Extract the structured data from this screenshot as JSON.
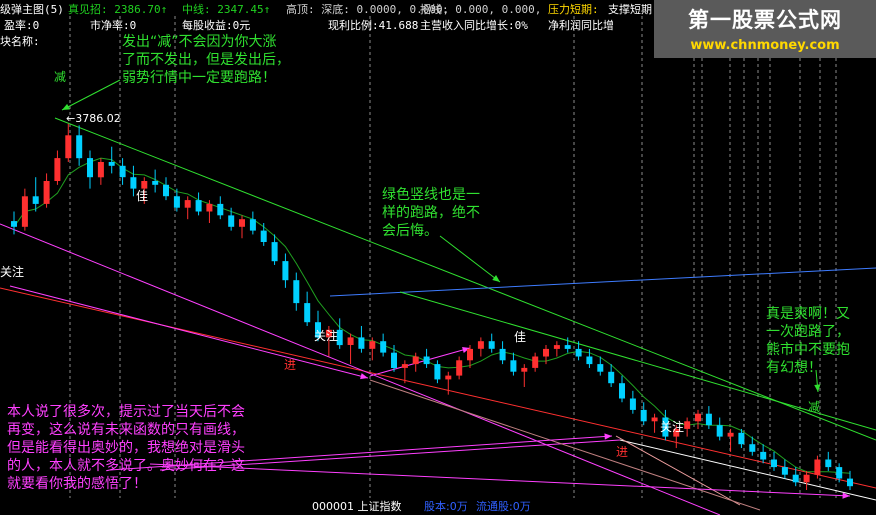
{
  "header": {
    "row1_left": "级弹主图(5)",
    "row1_items": [
      {
        "text": "真见招: 2386.70↑",
        "color": "#20d020"
      },
      {
        "text": "中线: 2347.45↑",
        "color": "#20d020"
      },
      {
        "text": "高顶: 深底: 0.0000, 0.000,",
        "color": "#d0d0d0"
      },
      {
        "text": "招线: 0.000, 0.000,",
        "color": "#d0d0d0"
      },
      {
        "text": "压力短期:",
        "color": "#ffd800"
      },
      {
        "text": "支撑短期",
        "color": "#ffffff"
      }
    ],
    "row2_items": [
      {
        "text": "盈率:0",
        "color": "#ffffff"
      },
      {
        "text": "市净率:0",
        "color": "#ffffff"
      },
      {
        "text": "每股收益:0元",
        "color": "#ffffff"
      },
      {
        "text": "现利比例:41.688",
        "color": "#ffffff"
      },
      {
        "text": "主营收入同比增长:0%",
        "color": "#ffffff"
      },
      {
        "text": "净利润同比增",
        "color": "#ffffff"
      }
    ],
    "row3_left": "块名称:"
  },
  "logo": {
    "line1": "第一股票公式网",
    "line2": "www.chnmoney.com"
  },
  "annotations": {
    "top_note": "发出“减”不会因为你大涨\n了而不发出，但是发出后，\n弱势行情中一定要跑路！",
    "mid_note": "绿色竖线也是一\n样的跑路，绝不\n会后悔。",
    "right_note": "真是爽啊！又\n一次跑路了，\n熊市中不要抱\n有幻想！",
    "left_note": "本人说了很多次，提示过了当天后不会\n再变，这么说有未来函数的只有画线，\n但是能看得出奥妙的，我想绝对是滑头\n的人，本人就不多说了。奥妙何在？这\n就要看你我的感悟了！"
  },
  "signals": {
    "jian": "减",
    "guanzhu": "关注",
    "jia": "佳",
    "jin": "进",
    "price_label": "←3786.02"
  },
  "footer": {
    "code": "000001 上证指数",
    "guben": "股本:0万",
    "liutong": "流通股:0万"
  },
  "chart_data": {
    "type": "candlestick",
    "price_high_label": 3786.02,
    "candles": [
      [
        3535,
        3560,
        3500,
        3520
      ],
      [
        3520,
        3620,
        3510,
        3600
      ],
      [
        3600,
        3650,
        3560,
        3580
      ],
      [
        3580,
        3660,
        3570,
        3640
      ],
      [
        3640,
        3720,
        3630,
        3700
      ],
      [
        3700,
        3790,
        3690,
        3760
      ],
      [
        3760,
        3786,
        3680,
        3700
      ],
      [
        3700,
        3720,
        3620,
        3650
      ],
      [
        3650,
        3700,
        3630,
        3690
      ],
      [
        3690,
        3730,
        3660,
        3680
      ],
      [
        3680,
        3700,
        3630,
        3650
      ],
      [
        3650,
        3680,
        3600,
        3620
      ],
      [
        3620,
        3650,
        3580,
        3640
      ],
      [
        3640,
        3670,
        3610,
        3630
      ],
      [
        3630,
        3650,
        3590,
        3600
      ],
      [
        3600,
        3620,
        3560,
        3570
      ],
      [
        3570,
        3600,
        3540,
        3590
      ],
      [
        3590,
        3610,
        3550,
        3560
      ],
      [
        3560,
        3590,
        3530,
        3580
      ],
      [
        3580,
        3600,
        3540,
        3550
      ],
      [
        3550,
        3570,
        3510,
        3520
      ],
      [
        3520,
        3550,
        3490,
        3540
      ],
      [
        3540,
        3560,
        3500,
        3510
      ],
      [
        3510,
        3530,
        3470,
        3480
      ],
      [
        3480,
        3500,
        3420,
        3430
      ],
      [
        3430,
        3450,
        3360,
        3380
      ],
      [
        3380,
        3400,
        3300,
        3320
      ],
      [
        3320,
        3350,
        3260,
        3270
      ],
      [
        3270,
        3300,
        3220,
        3230
      ],
      [
        3230,
        3260,
        3180,
        3250
      ],
      [
        3250,
        3280,
        3200,
        3210
      ],
      [
        3210,
        3240,
        3160,
        3230
      ],
      [
        3230,
        3260,
        3190,
        3200
      ],
      [
        3200,
        3230,
        3170,
        3220
      ],
      [
        3220,
        3240,
        3180,
        3190
      ],
      [
        3190,
        3210,
        3140,
        3150
      ],
      [
        3150,
        3170,
        3110,
        3160
      ],
      [
        3160,
        3190,
        3140,
        3180
      ],
      [
        3180,
        3200,
        3150,
        3160
      ],
      [
        3160,
        3170,
        3110,
        3120
      ],
      [
        3120,
        3140,
        3080,
        3130
      ],
      [
        3130,
        3180,
        3120,
        3170
      ],
      [
        3170,
        3210,
        3150,
        3200
      ],
      [
        3200,
        3230,
        3180,
        3220
      ],
      [
        3220,
        3240,
        3190,
        3200
      ],
      [
        3200,
        3220,
        3160,
        3170
      ],
      [
        3170,
        3190,
        3130,
        3140
      ],
      [
        3140,
        3160,
        3100,
        3150
      ],
      [
        3150,
        3190,
        3140,
        3180
      ],
      [
        3180,
        3210,
        3160,
        3200
      ],
      [
        3200,
        3220,
        3180,
        3210
      ],
      [
        3210,
        3230,
        3190,
        3200
      ],
      [
        3200,
        3220,
        3170,
        3180
      ],
      [
        3180,
        3200,
        3150,
        3160
      ],
      [
        3160,
        3180,
        3130,
        3140
      ],
      [
        3140,
        3160,
        3100,
        3110
      ],
      [
        3110,
        3130,
        3060,
        3070
      ],
      [
        3070,
        3090,
        3030,
        3040
      ],
      [
        3040,
        3060,
        3000,
        3010
      ],
      [
        3010,
        3030,
        2980,
        3020
      ],
      [
        3020,
        3040,
        2960,
        2970
      ],
      [
        2970,
        3000,
        2940,
        2990
      ],
      [
        2990,
        3020,
        2970,
        3010
      ],
      [
        3010,
        3040,
        2990,
        3030
      ],
      [
        3030,
        3050,
        2990,
        3000
      ],
      [
        3000,
        3020,
        2960,
        2970
      ],
      [
        2970,
        2990,
        2930,
        2980
      ],
      [
        2980,
        2990,
        2940,
        2950
      ],
      [
        2950,
        2970,
        2920,
        2930
      ],
      [
        2930,
        2950,
        2900,
        2910
      ],
      [
        2910,
        2930,
        2880,
        2890
      ],
      [
        2890,
        2910,
        2860,
        2870
      ],
      [
        2870,
        2890,
        2840,
        2850
      ],
      [
        2850,
        2880,
        2830,
        2870
      ],
      [
        2870,
        2920,
        2860,
        2910
      ],
      [
        2910,
        2930,
        2880,
        2890
      ],
      [
        2890,
        2900,
        2850,
        2860
      ],
      [
        2860,
        2880,
        2830,
        2840
      ]
    ]
  },
  "colors": {
    "up": "#ff3030",
    "down": "#00d0ff",
    "annotation_green": "#30e030",
    "annotation_magenta": "#ff40ff",
    "guanzhu_candle": "#ff9de0"
  }
}
